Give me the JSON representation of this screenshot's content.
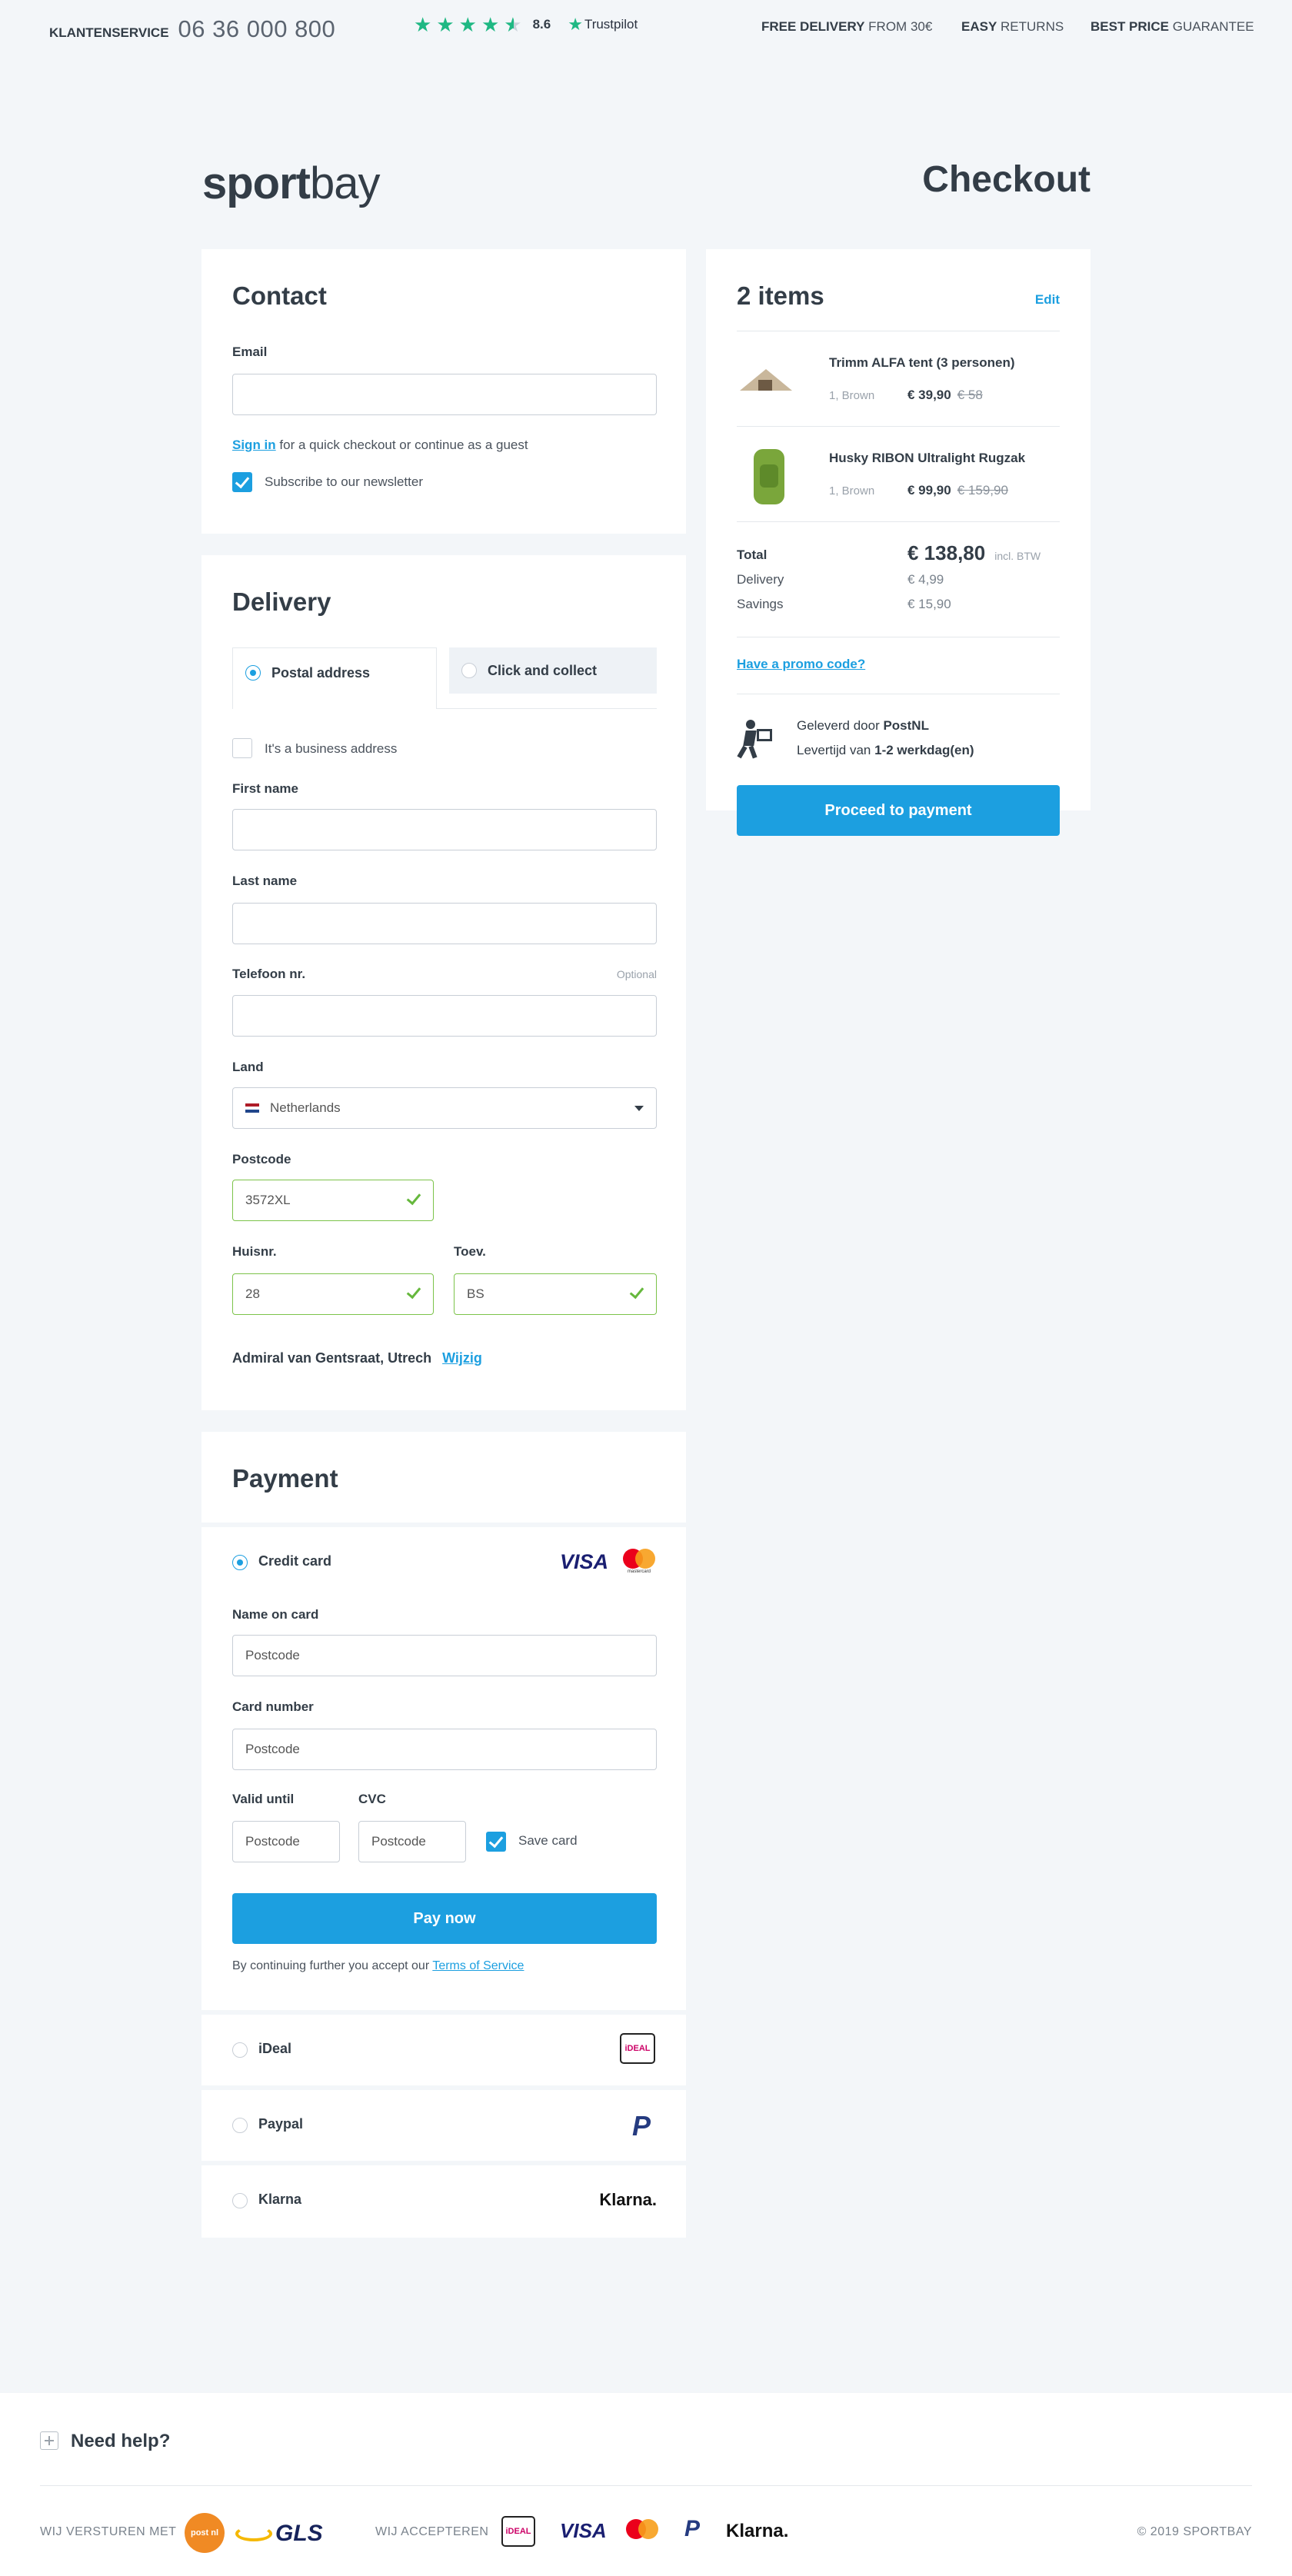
{
  "topbar": {
    "service_label": "KLANTENSERVICE",
    "phone": "06 36 000 800",
    "rating": "8.6",
    "trustpilot": "Trustpilot",
    "usp1_bold": "FREE DELIVERY",
    "usp1_rest": " FROM 30€",
    "usp2_bold": "EASY",
    "usp2_rest": " RETURNS",
    "usp3_bold": "BEST PRICE",
    "usp3_rest": " GUARANTEE",
    "trustpilot_stars": 4.5
  },
  "brand": {
    "logo_bold": "sport",
    "logo_light": "bay"
  },
  "page_title": "Checkout",
  "contact": {
    "heading": "Contact",
    "email_label": "Email",
    "email_value": "",
    "signin_link": "Sign in",
    "signin_rest": " for a quick checkout or continue as a guest",
    "newsletter_label": "Subscribe to our newsletter",
    "newsletter_checked": true
  },
  "delivery": {
    "heading": "Delivery",
    "tab_postal": "Postal address",
    "tab_collect": "Click and collect",
    "business_label": "It's a business address",
    "first_name_label": "First name",
    "last_name_label": "Last name",
    "phone_label": "Telefoon nr.",
    "optional": "Optional",
    "country_label": "Land",
    "country_value": "Netherlands",
    "postcode_label": "Postcode",
    "postcode_value": "3572XL",
    "house_label": "Huisnr.",
    "house_value": "28",
    "addition_label": "Toev.",
    "addition_value": "BS",
    "address_text": "Admiral van Gentsraat, Utrech",
    "change_link": "Wijzig"
  },
  "payment": {
    "heading": "Payment",
    "credit_label": "Credit card",
    "visa": "VISA",
    "mastercard_text": "mastercard",
    "name_label": "Name on card",
    "name_placeholder": "Postcode",
    "number_label": "Card number",
    "number_placeholder": "Postcode",
    "valid_label": "Valid until",
    "valid_placeholder": "Postcode",
    "cvc_label": "CVC",
    "cvc_placeholder": "Postcode",
    "save_card_label": "Save card",
    "pay_button": "Pay now",
    "terms_pre": "By continuing further you accept our ",
    "terms_link": "Terms of Service",
    "ideal_label": "iDeal",
    "paypal_label": "Paypal",
    "klarna_label": "Klarna",
    "klarna_logo": "Klarna.",
    "ideal_logo": "iDEAL"
  },
  "cart": {
    "heading": "2 items",
    "edit_link": "Edit",
    "items": [
      {
        "title": "Trimm ALFA tent (3 personen)",
        "meta": "1, Brown",
        "price": "€ 39,90",
        "old_price": "€ 58"
      },
      {
        "title": "Husky RIBON Ultralight Rugzak",
        "meta": "1, Brown",
        "price": "€ 99,90",
        "old_price": "€ 159,90"
      }
    ],
    "total_label": "Total",
    "total_value": "€ 138,80",
    "total_note": "incl. BTW",
    "delivery_label": "Delivery",
    "delivery_value": "€ 4,99",
    "savings_label": "Savings",
    "savings_value": "€ 15,90",
    "promo_link": "Have a promo code?",
    "postnl_pre": "Geleverd door ",
    "postnl_bold": "PostNL",
    "leadtime_pre": "Levertijd van ",
    "leadtime_bold": "1-2 werkdag(en)",
    "proceed_button": "Proceed to payment"
  },
  "footer": {
    "help": "Need help?",
    "ship_label": "WIJ VERSTUREN MET",
    "gls": "GLS",
    "postnl_logo": "post nl",
    "accept_label": "WIJ ACCEPTEREN",
    "visa": "VISA",
    "klarna": "Klarna.",
    "copyright": "© 2019 SPORTBAY"
  },
  "colors": {
    "accent": "#1c9fe0",
    "success": "#7cc34a",
    "trustpilot": "#1fb883",
    "text": "#333d47",
    "background": "#f3f6f9"
  }
}
